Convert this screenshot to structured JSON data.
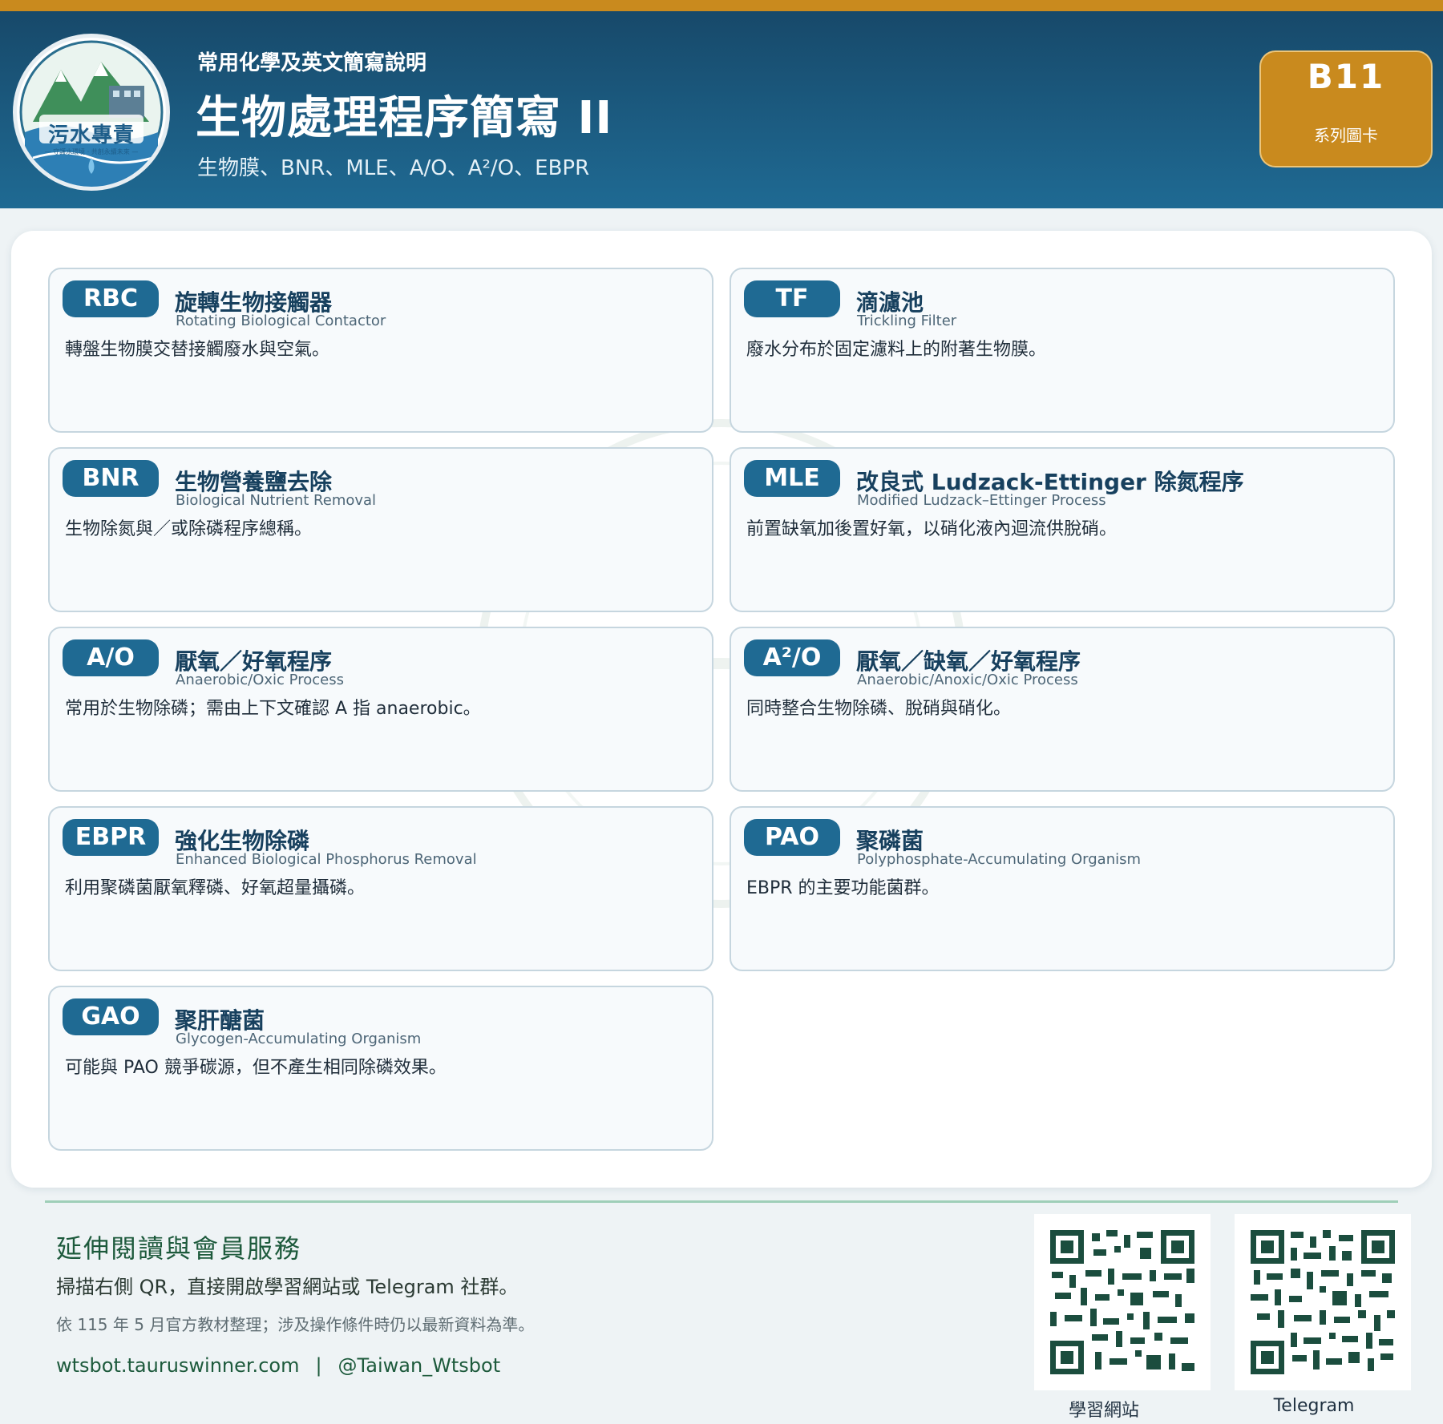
{
  "header": {
    "logo_text": "污水專責",
    "logo_tagline": "— 守護水環境 · 共創永續未來 —",
    "kicker": "常用化學及英文簡寫說明",
    "title": "生物處理程序簡寫 II",
    "subtitle": "生物膜、BNR、MLE、A/O、A²/O、EBPR",
    "badge_code": "B11",
    "badge_label": "系列圖卡"
  },
  "cards": [
    {
      "abbr": "RBC",
      "zh": "旋轉生物接觸器",
      "en": "Rotating Biological Contactor",
      "desc": "轉盤生物膜交替接觸廢水與空氣。"
    },
    {
      "abbr": "TF",
      "zh": "滴濾池",
      "en": "Trickling Filter",
      "desc": "廢水分布於固定濾料上的附著生物膜。"
    },
    {
      "abbr": "BNR",
      "zh": "生物營養鹽去除",
      "en": "Biological Nutrient Removal",
      "desc": "生物除氮與／或除磷程序總稱。"
    },
    {
      "abbr": "MLE",
      "zh": "改良式 Ludzack-Ettinger 除氮程序",
      "en": "Modified Ludzack–Ettinger Process",
      "desc": "前置缺氧加後置好氧，以硝化液內迴流供脫硝。"
    },
    {
      "abbr": "A/O",
      "zh": "厭氧／好氧程序",
      "en": "Anaerobic/Oxic Process",
      "desc": "常用於生物除磷；需由上下文確認 A 指 anaerobic。"
    },
    {
      "abbr": "A²/O",
      "zh": "厭氧／缺氧／好氧程序",
      "en": "Anaerobic/Anoxic/Oxic Process",
      "desc": "同時整合生物除磷、脫硝與硝化。"
    },
    {
      "abbr": "EBPR",
      "zh": "強化生物除磷",
      "en": "Enhanced Biological Phosphorus Removal",
      "desc": "利用聚磷菌厭氧釋磷、好氧超量攝磷。"
    },
    {
      "abbr": "PAO",
      "zh": "聚磷菌",
      "en": "Polyphosphate-Accumulating Organism",
      "desc": "EBPR 的主要功能菌群。"
    },
    {
      "abbr": "GAO",
      "zh": "聚肝醣菌",
      "en": "Glycogen-Accumulating Organism",
      "desc": "可能與 PAO 競爭碳源，但不產生相同除磷效果。"
    }
  ],
  "footer": {
    "heading": "延伸閱讀與會員服務",
    "text": "掃描右側 QR，直接開啟學習網站或 Telegram 社群。",
    "note": "依 115 年 5 月官方教材整理；涉及操作條件時仍以最新資料為準。",
    "link_site": "wtsbot.tauruswinner.com",
    "link_sep": "|",
    "link_telegram": "@Taiwan_Wtsbot",
    "qr_site_label": "學習網站",
    "qr_telegram_label": "Telegram"
  },
  "colors": {
    "accent_gold": "#c98a1e",
    "header_blue": "#1f6a93",
    "pill_blue": "#1f6a93",
    "footer_green": "#1d5a3c"
  }
}
